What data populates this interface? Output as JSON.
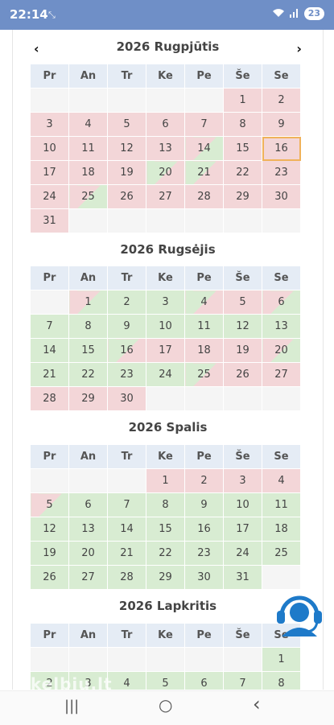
{
  "status": {
    "time": "22:14",
    "noti_icon": "missed-call-icon",
    "battery": "23"
  },
  "nav": {
    "prev": "‹",
    "next": "›"
  },
  "weekdays": [
    "Pr",
    "An",
    "Tr",
    "Ke",
    "Pe",
    "Še",
    "Se"
  ],
  "months": [
    {
      "title": "2026 Rugpjūtis",
      "rows": [
        [
          [
            "",
            "b"
          ],
          [
            "",
            "b"
          ],
          [
            "",
            "b"
          ],
          [
            "",
            "b"
          ],
          [
            "",
            "b"
          ],
          [
            "1",
            "r"
          ],
          [
            "2",
            "r"
          ]
        ],
        [
          [
            "3",
            "r"
          ],
          [
            "4",
            "r"
          ],
          [
            "5",
            "r"
          ],
          [
            "6",
            "r"
          ],
          [
            "7",
            "r"
          ],
          [
            "8",
            "r"
          ],
          [
            "9",
            "r"
          ]
        ],
        [
          [
            "10",
            "r"
          ],
          [
            "11",
            "r"
          ],
          [
            "12",
            "r"
          ],
          [
            "13",
            "r"
          ],
          [
            "14",
            "rg"
          ],
          [
            "15",
            "r"
          ],
          [
            "16",
            "r sel"
          ]
        ],
        [
          [
            "17",
            "r"
          ],
          [
            "18",
            "r"
          ],
          [
            "19",
            "r"
          ],
          [
            "20",
            "gr"
          ],
          [
            "21",
            "gr"
          ],
          [
            "22",
            "r"
          ],
          [
            "23",
            "r"
          ]
        ],
        [
          [
            "24",
            "r"
          ],
          [
            "25",
            "rg"
          ],
          [
            "26",
            "r"
          ],
          [
            "27",
            "r"
          ],
          [
            "28",
            "r"
          ],
          [
            "29",
            "r"
          ],
          [
            "30",
            "r"
          ]
        ],
        [
          [
            "31",
            "r"
          ],
          [
            "",
            "b"
          ],
          [
            "",
            "b"
          ],
          [
            "",
            "b"
          ],
          [
            "",
            "b"
          ],
          [
            "",
            "b"
          ],
          [
            "",
            "b"
          ]
        ]
      ]
    },
    {
      "title": "2026 Rugsėjis",
      "rows": [
        [
          [
            "",
            "b"
          ],
          [
            "1",
            "rg"
          ],
          [
            "2",
            "g"
          ],
          [
            "3",
            "g"
          ],
          [
            "4",
            "gr"
          ],
          [
            "5",
            "r"
          ],
          [
            "6",
            "rg"
          ]
        ],
        [
          [
            "7",
            "g"
          ],
          [
            "8",
            "g"
          ],
          [
            "9",
            "g"
          ],
          [
            "10",
            "g"
          ],
          [
            "11",
            "g"
          ],
          [
            "12",
            "g"
          ],
          [
            "13",
            "g"
          ]
        ],
        [
          [
            "14",
            "g"
          ],
          [
            "15",
            "g"
          ],
          [
            "16",
            "gr"
          ],
          [
            "17",
            "r"
          ],
          [
            "18",
            "r"
          ],
          [
            "19",
            "r"
          ],
          [
            "20",
            "rg"
          ]
        ],
        [
          [
            "21",
            "g"
          ],
          [
            "22",
            "g"
          ],
          [
            "23",
            "g"
          ],
          [
            "24",
            "g"
          ],
          [
            "25",
            "gr"
          ],
          [
            "26",
            "r"
          ],
          [
            "27",
            "r"
          ]
        ],
        [
          [
            "28",
            "r"
          ],
          [
            "29",
            "r"
          ],
          [
            "30",
            "r"
          ],
          [
            "",
            "b"
          ],
          [
            "",
            "b"
          ],
          [
            "",
            "b"
          ],
          [
            "",
            "b"
          ]
        ]
      ]
    },
    {
      "title": "2026 Spalis",
      "rows": [
        [
          [
            "",
            "b"
          ],
          [
            "",
            "b"
          ],
          [
            "",
            "b"
          ],
          [
            "1",
            "r"
          ],
          [
            "2",
            "r"
          ],
          [
            "3",
            "r"
          ],
          [
            "4",
            "r"
          ]
        ],
        [
          [
            "5",
            "rg"
          ],
          [
            "6",
            "g"
          ],
          [
            "7",
            "g"
          ],
          [
            "8",
            "g"
          ],
          [
            "9",
            "g"
          ],
          [
            "10",
            "g"
          ],
          [
            "11",
            "g"
          ]
        ],
        [
          [
            "12",
            "g"
          ],
          [
            "13",
            "g"
          ],
          [
            "14",
            "g"
          ],
          [
            "15",
            "g"
          ],
          [
            "16",
            "g"
          ],
          [
            "17",
            "g"
          ],
          [
            "18",
            "g"
          ]
        ],
        [
          [
            "19",
            "g"
          ],
          [
            "20",
            "g"
          ],
          [
            "21",
            "g"
          ],
          [
            "22",
            "g"
          ],
          [
            "23",
            "g"
          ],
          [
            "24",
            "g"
          ],
          [
            "25",
            "g"
          ]
        ],
        [
          [
            "26",
            "g"
          ],
          [
            "27",
            "g"
          ],
          [
            "28",
            "g"
          ],
          [
            "29",
            "g"
          ],
          [
            "30",
            "g"
          ],
          [
            "31",
            "g"
          ],
          [
            "",
            "b"
          ]
        ]
      ]
    },
    {
      "title": "2026 Lapkritis",
      "rows": [
        [
          [
            "",
            "b"
          ],
          [
            "",
            "b"
          ],
          [
            "",
            "b"
          ],
          [
            "",
            "b"
          ],
          [
            "",
            "b"
          ],
          [
            "",
            "b"
          ],
          [
            "1",
            "g"
          ]
        ],
        [
          [
            "2",
            "g"
          ],
          [
            "3",
            "g"
          ],
          [
            "4",
            "g"
          ],
          [
            "5",
            "g"
          ],
          [
            "6",
            "g"
          ],
          [
            "7",
            "g"
          ],
          [
            "8",
            "g"
          ]
        ]
      ]
    }
  ],
  "watermark": "skelbiu.lt",
  "colors": {
    "booked": "#f3d6d8",
    "free": "#d8ecd2",
    "header": "#e5ecf5",
    "selected": "#f0b25a"
  },
  "android_nav": {
    "recents": "|||",
    "home": "○",
    "back": "‹"
  }
}
